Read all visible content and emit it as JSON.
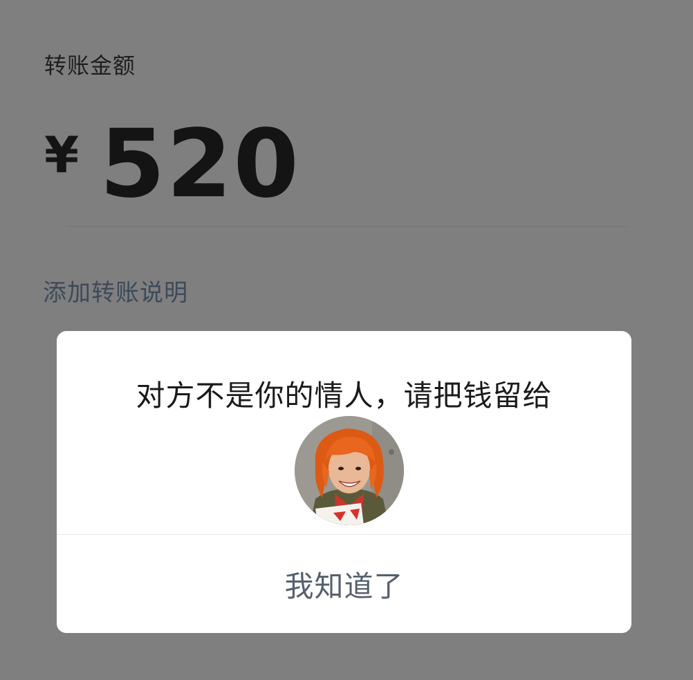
{
  "transfer": {
    "amount_label": "转账金额",
    "currency_symbol": "¥",
    "amount": "520",
    "add_note_label": "添加转账说明"
  },
  "dialog": {
    "message": "对方不是你的情人，请把钱留给",
    "confirm_label": "我知道了",
    "avatar_icon": "person-photo"
  },
  "colors": {
    "backdrop": "#7f7f7f",
    "link": "#3d4a5a",
    "dialog_button_text": "#56606e",
    "avatar_hair": "#e8661d"
  }
}
